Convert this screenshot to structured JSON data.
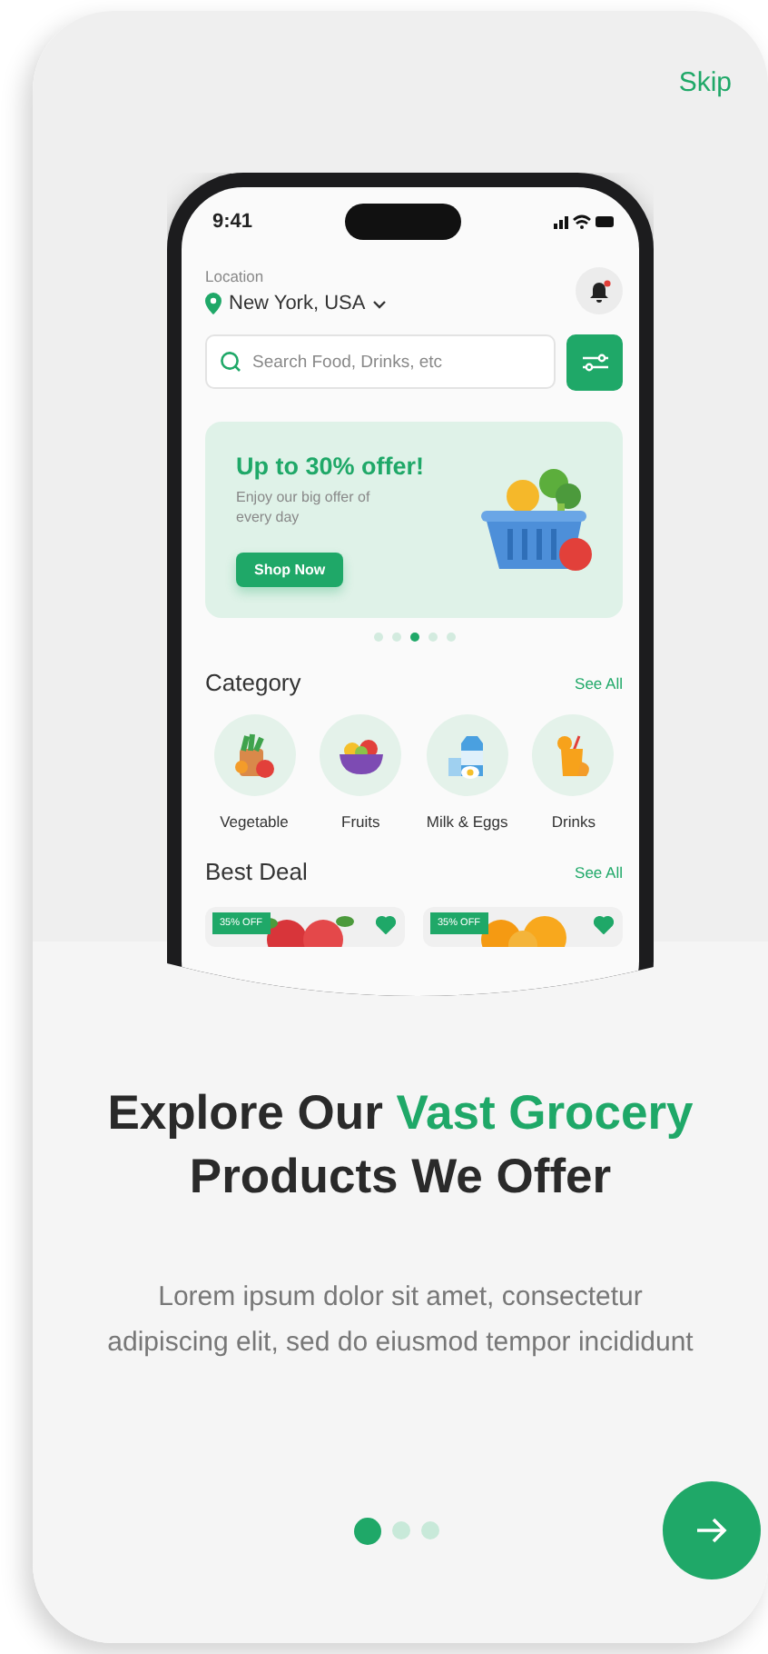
{
  "skip": "Skip",
  "phone": {
    "time": "9:41",
    "location_label": "Location",
    "location": "New York, USA",
    "notification_unread": true,
    "search": {
      "placeholder": "Search Food, Drinks, etc"
    },
    "banner": {
      "title": "Up to 30% offer!",
      "subtitle": "Enjoy our big offer of every day",
      "button": "Shop Now"
    },
    "banner_dots": [
      {
        "selected": false
      },
      {
        "selected": false
      },
      {
        "selected": true
      },
      {
        "selected": false
      },
      {
        "selected": false
      }
    ],
    "category": {
      "heading": "Category",
      "see_all": "See All",
      "items": [
        {
          "kind": "vegetable",
          "label": "Vegetable"
        },
        {
          "kind": "fruit",
          "label": "Fruits"
        },
        {
          "kind": "dairy",
          "label": "Milk & Eggs"
        },
        {
          "kind": "drink",
          "label": "Drinks"
        }
      ]
    },
    "best_deal": {
      "heading": "Best Deal",
      "see_all": "See All",
      "items": [
        {
          "kind": "apple",
          "badge": "35% OFF",
          "favorite": true
        },
        {
          "kind": "orange",
          "badge": "35% OFF",
          "favorite": true
        }
      ]
    }
  },
  "headline": "Explore Our *Vast Grocery* Products We Offer",
  "description": "Lorem ipsum dolor sit amet, consectetur adipiscing elit, sed do eiusmod tempor incididunt",
  "pager": [
    {
      "selected": true
    },
    {
      "selected": false
    },
    {
      "selected": false
    }
  ]
}
